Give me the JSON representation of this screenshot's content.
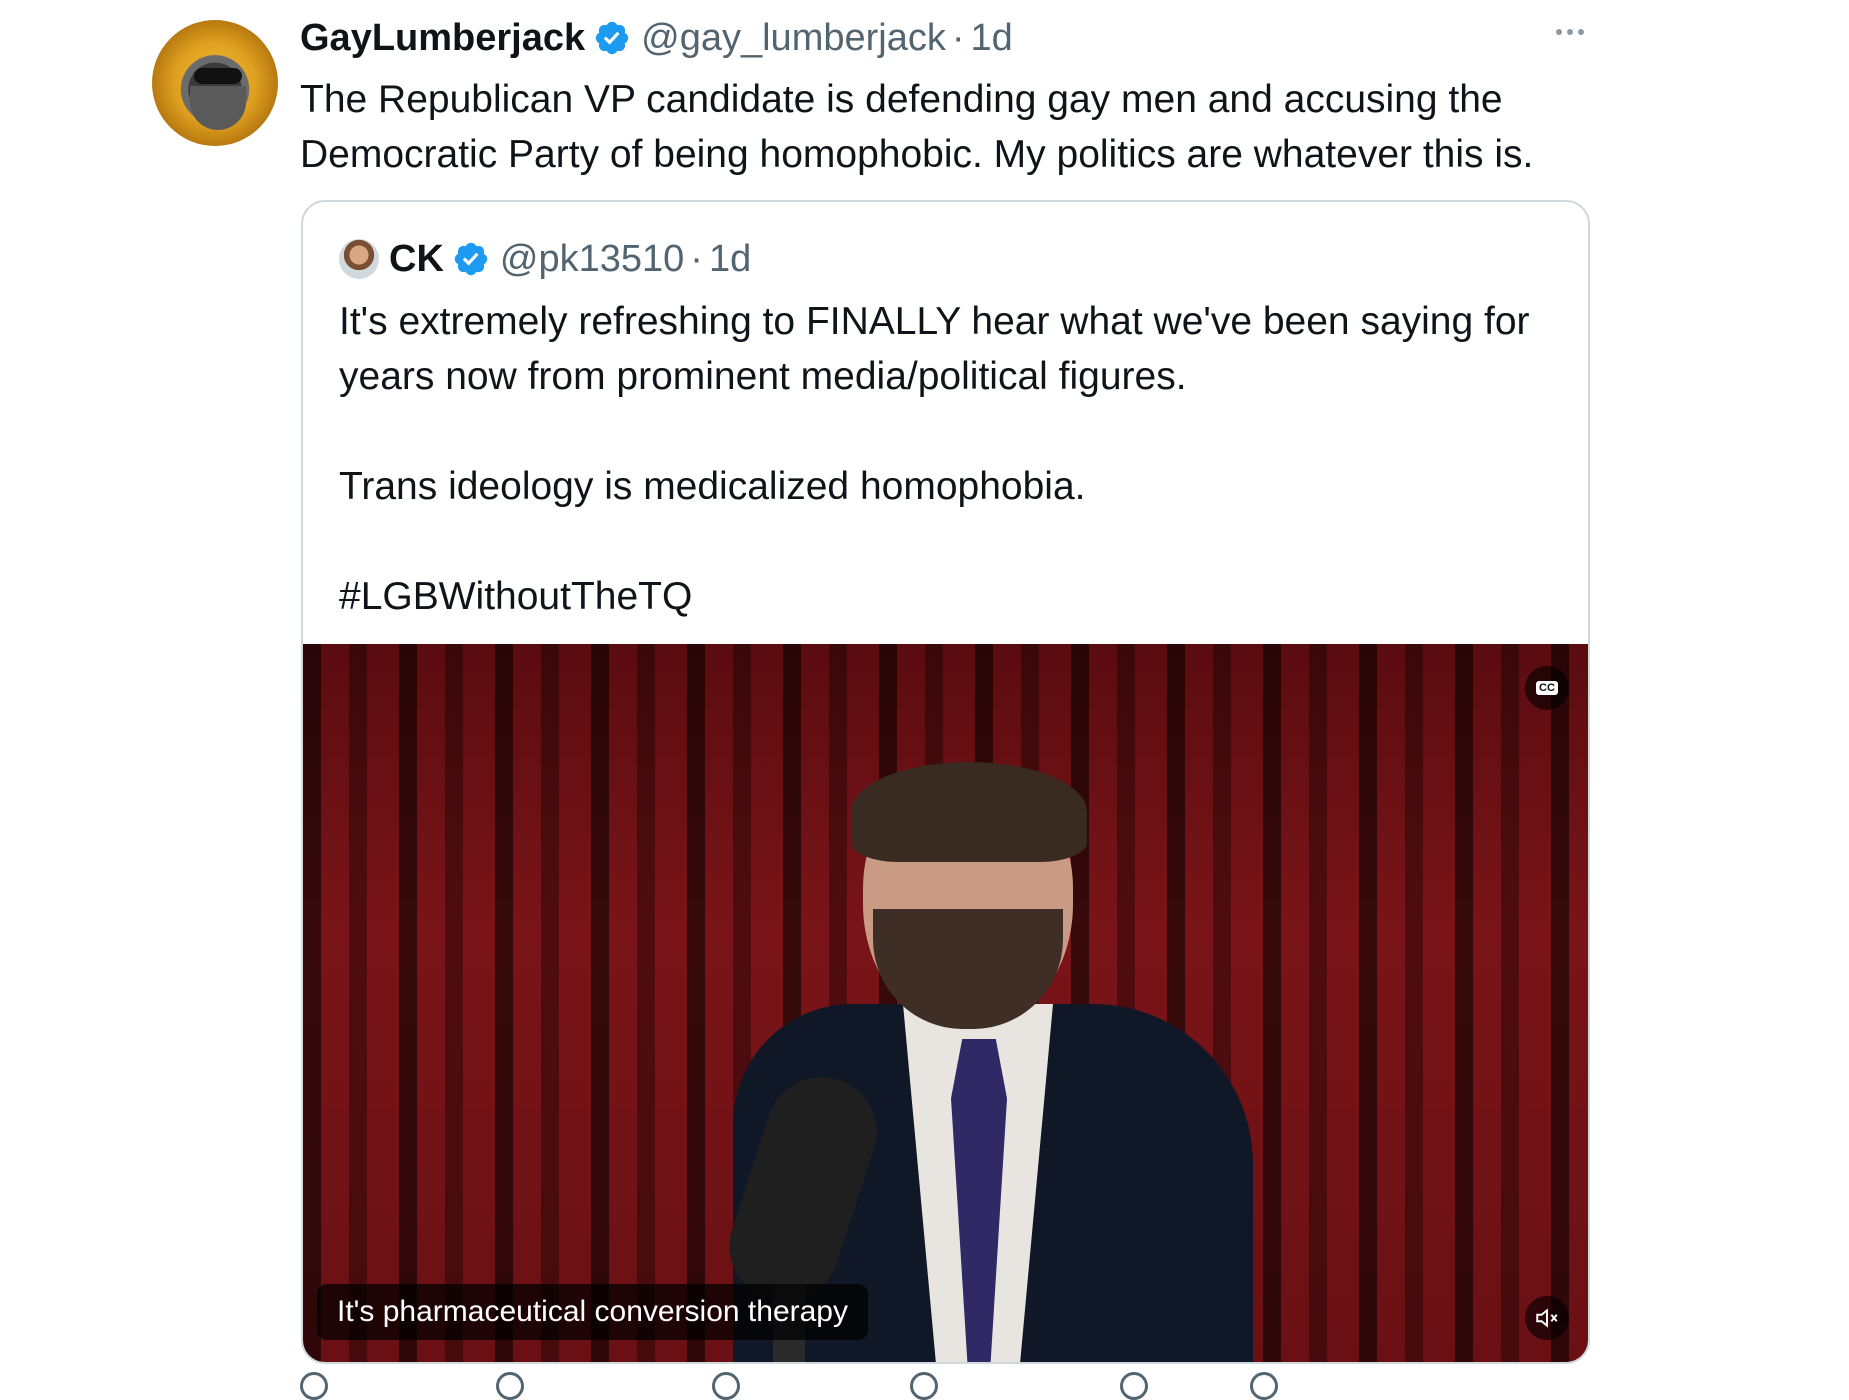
{
  "tweet": {
    "author_name": "GayLumberjack",
    "author_handle": "@gay_lumberjack",
    "separator": "·",
    "time": "1d",
    "text": "The Republican VP candidate is defending gay men and accusing the Democratic Party of being homophobic. My politics are whatever this is."
  },
  "quoted_tweet": {
    "author_name": "CK",
    "author_handle": "@pk13510",
    "separator": "·",
    "time": "1d",
    "text": "It's extremely refreshing to FINALLY hear what we've been saying for years now from prominent media/political figures.\n\nTrans ideology is medicalized homophobia.\n\n#LGBWithoutTheTQ"
  },
  "video": {
    "caption": "It's pharmaceutical conversion therapy",
    "cc_label": "CC"
  },
  "icons": {
    "verified": "verified-badge-icon",
    "more": "more-icon",
    "mute": "mute-icon",
    "cc": "closed-captions-icon"
  },
  "colors": {
    "verified_blue": "#1d9bf0",
    "secondary_text": "#536471",
    "border": "#cfd9de"
  }
}
